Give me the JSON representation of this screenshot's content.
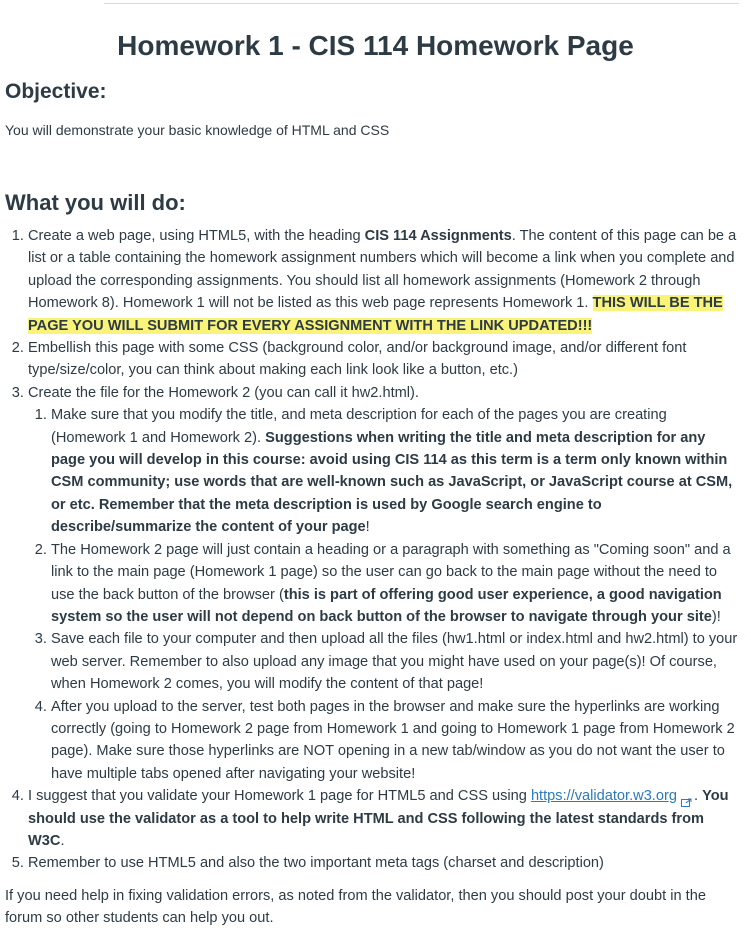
{
  "title": "Homework 1 - CIS 114 Homework Page",
  "objective": {
    "heading": "Objective:",
    "text": "You will demonstrate your basic knowledge of HTML and CSS"
  },
  "what": {
    "heading": "What you will do:",
    "item1": {
      "t1": "Create a web page, using HTML5, with the heading ",
      "b1": "CIS 114 Assignments",
      "t2": ". The content of this page can be a list or a table containing the homework assignment numbers which will become a link when you complete and upload the corresponding assignments. You should list all homework assignments (Homework 2 through Homework 8). Homework 1 will not be listed as this web page represents Homework 1. ",
      "highlight": "THIS WILL BE THE PAGE YOU WILL SUBMIT FOR EVERY ASSIGNMENT WITH THE LINK UPDATED!!!"
    },
    "item2": "Embellish this page with some CSS (background color, and/or background image, and/or different font type/size/color, you can think about making each link look like a button, etc.)",
    "item3": {
      "text": "Create the file for the Homework 2 (you can call it hw2.html).",
      "sub1": {
        "t1": "Make sure that you modify the title, and meta description for each of the pages you are creating (Homework 1 and Homework 2). ",
        "b1": "Suggestions when writing the title and meta description for any page you will develop in this course: avoid using CIS 114 as this term is a term only known within CSM community; use words that are well-known such as JavaScript, or JavaScript course at CSM, or etc. Remember that the meta description is used by Google search engine to describe/summarize the content of your page",
        "t2": "!"
      },
      "sub2": {
        "t1": "The Homework 2 page will just contain a heading or a paragraph with something as \"Coming soon\" and a link to the main page (Homework 1 page) so the user can go back to the main page without the need to use the back button of the browser (",
        "b1": "this is part of offering good user experience, a good navigation system so the user will not depend on back button of the browser to navigate through your site",
        "t2": ")!"
      },
      "sub3": "Save each file to your computer and then upload all the files (hw1.html or index.html and hw2.html) to your web server. Remember to also upload any image that you might have used on your page(s)! Of course, when Homework 2 comes, you will modify the content of that page!",
      "sub4": "After you upload to the server, test both pages in the browser and make sure the hyperlinks are working correctly (going to Homework 2 page from Homework 1 and going to Homework 1 page from Homework 2 page). Make sure those hyperlinks are NOT opening in a new tab/window as you do not want the user to have multiple tabs opened after navigating your website!"
    },
    "item4": {
      "t1": "I suggest that you validate your Homework 1 page for HTML5 and CSS using ",
      "link": "https://validator.w3.org",
      "t2": ". ",
      "b1": "You should use the validator as a tool to help write HTML and CSS following the latest standards from W3C",
      "t3": "."
    },
    "item5": "Remember to use HTML5 and also the two important meta tags (charset and description)"
  },
  "final": "If you need help in fixing validation errors, as noted from the validator, then you should post your doubt in the forum so other students can help you out.",
  "icons": {
    "external_link": "external-link-icon"
  },
  "colors": {
    "highlight": "#faf37a",
    "link": "#2b7abc",
    "text": "#2d3b45"
  }
}
